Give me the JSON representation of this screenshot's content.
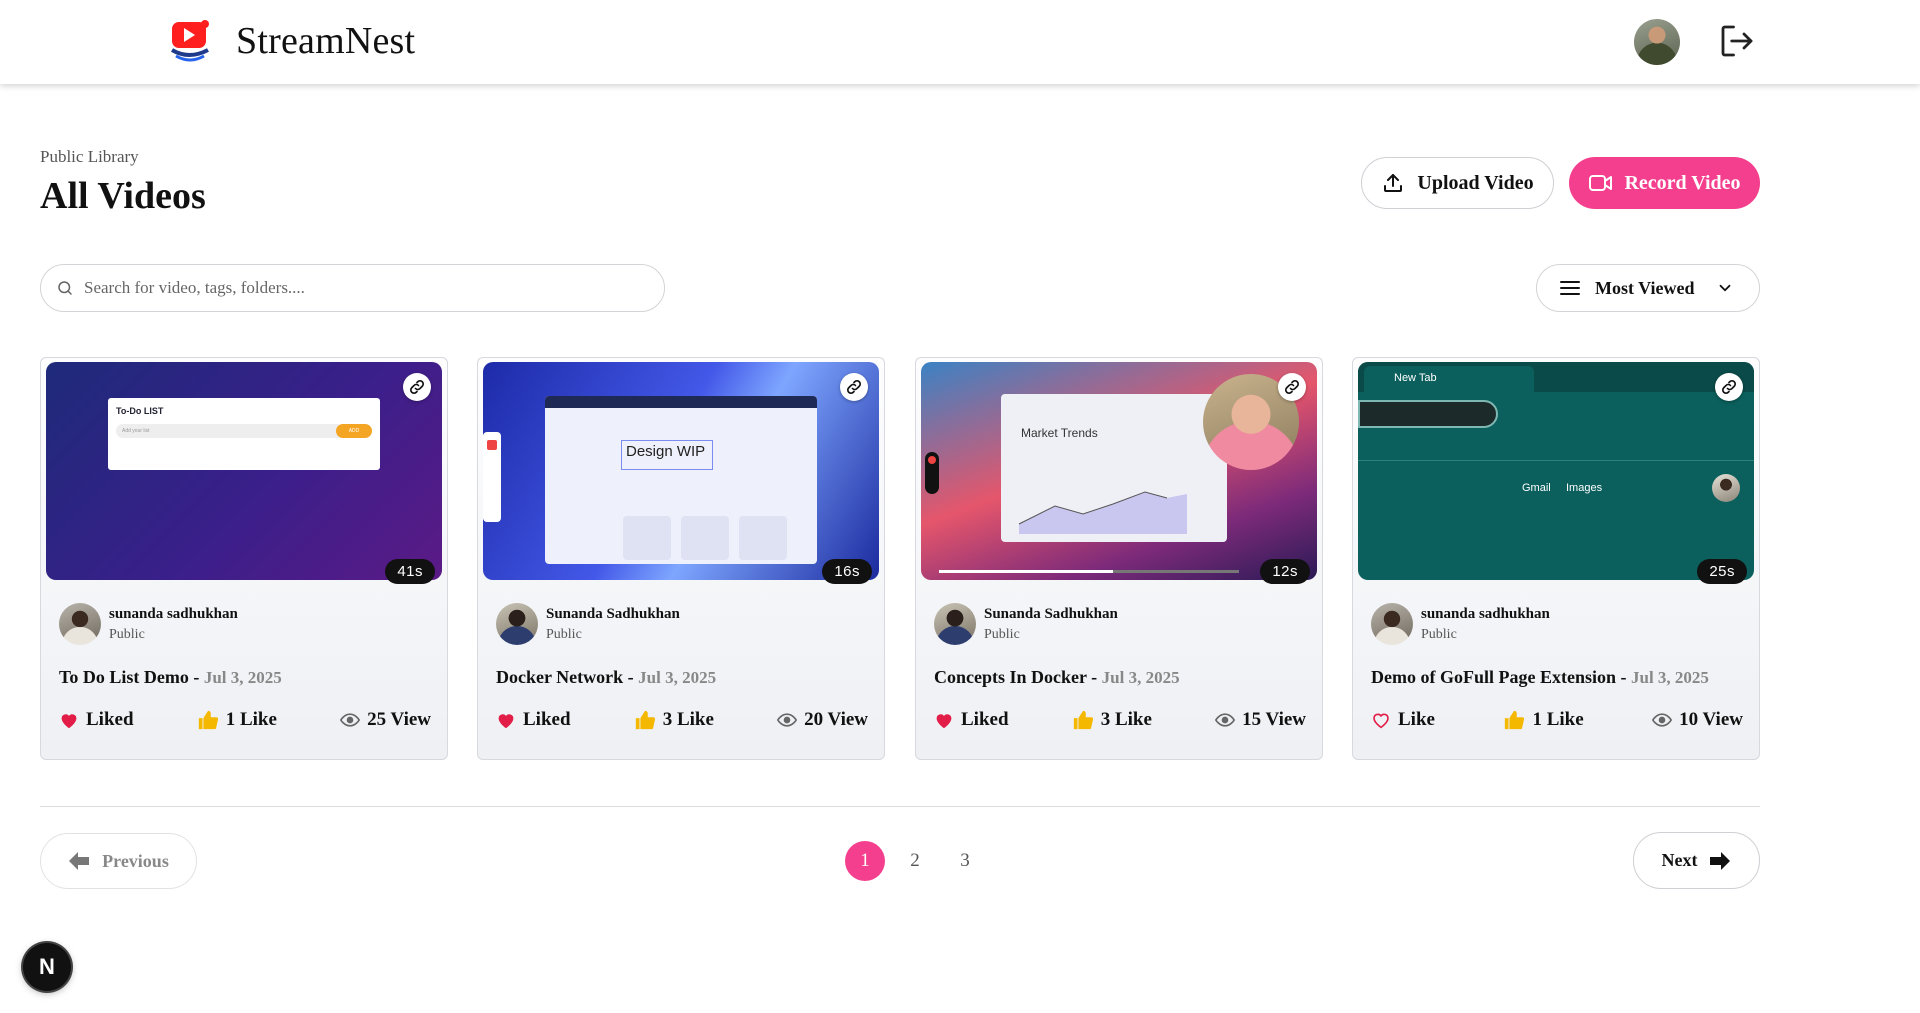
{
  "app": {
    "name": "StreamNest",
    "logo_icon": "play-logo-icon",
    "logout_icon": "logout-icon"
  },
  "header": {
    "breadcrumb": "Public Library",
    "title": "All Videos",
    "upload_label": "Upload Video",
    "record_label": "Record Video"
  },
  "search": {
    "placeholder": "Search for video, tags, folders....",
    "value": ""
  },
  "sort": {
    "selected": "Most Viewed"
  },
  "videos": [
    {
      "author": "sunanda sadhukhan",
      "visibility": "Public",
      "title": "To Do List Demo",
      "date": "Jul 3, 2025",
      "duration": "41s",
      "like_state": "Liked",
      "liked": true,
      "likes": "1 Like",
      "views": "25 View",
      "thumb_text": [
        "To-Do LIST",
        "Add your list",
        "ADD"
      ]
    },
    {
      "author": "Sunanda Sadhukhan",
      "visibility": "Public",
      "title": "Docker Network",
      "date": "Jul 3, 2025",
      "duration": "16s",
      "like_state": "Liked",
      "liked": true,
      "likes": "3 Like",
      "views": "20 View",
      "thumb_text": [
        "Design WIP"
      ]
    },
    {
      "author": "Sunanda Sadhukhan",
      "visibility": "Public",
      "title": "Concepts In Docker",
      "date": "Jul 3, 2025",
      "duration": "12s",
      "like_state": "Liked",
      "liked": true,
      "likes": "3 Like",
      "views": "15 View",
      "thumb_text": [
        "Market Trends"
      ]
    },
    {
      "author": "sunanda sadhukhan",
      "visibility": "Public",
      "title": "Demo of GoFull Page Extension",
      "date": "Jul 3, 2025",
      "duration": "25s",
      "like_state": "Like",
      "liked": false,
      "likes": "1 Like",
      "views": "10 View",
      "thumb_text": [
        "New Tab",
        "Gmail",
        "Images"
      ]
    }
  ],
  "pagination": {
    "prev_label": "Previous",
    "next_label": "Next",
    "pages": [
      "1",
      "2",
      "3"
    ],
    "current": "1"
  },
  "dev_badge": "N",
  "colors": {
    "accent": "#f43f8e",
    "heart": "#e11d48",
    "thumb": "#f5b800"
  }
}
